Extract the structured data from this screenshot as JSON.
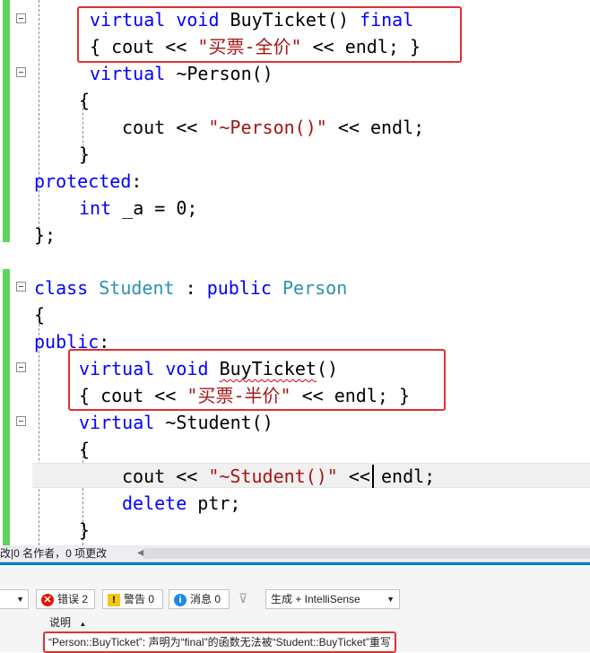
{
  "editor": {
    "lines": [
      {
        "segments": [
          [
            "kw",
            "virtual"
          ],
          [
            "",
            "void"
          ],
          [
            "",
            "BuyTicket() "
          ],
          [
            "kw",
            "final"
          ]
        ]
      },
      {
        "segments": [
          [
            "",
            "{ cout << "
          ],
          [
            "st",
            "\"买票-全价\""
          ],
          [
            "",
            " << endl; }"
          ]
        ]
      },
      {
        "segments": [
          [
            "kw",
            "virtual"
          ],
          [
            "",
            " ~Person()"
          ]
        ]
      },
      {
        "segments": [
          [
            "",
            "{"
          ]
        ]
      },
      {
        "segments": [
          [
            "",
            "cout << "
          ],
          [
            "st",
            "\"~Person()\""
          ],
          [
            "",
            " << endl;"
          ]
        ]
      },
      {
        "segments": [
          [
            "",
            "}"
          ]
        ]
      },
      {
        "segments": [
          [
            "kw",
            "protected"
          ],
          [
            "",
            ":"
          ]
        ]
      },
      {
        "segments": [
          [
            "kw",
            "int"
          ],
          [
            "",
            " _a = 0;"
          ]
        ]
      },
      {
        "segments": [
          [
            "",
            "};"
          ]
        ]
      },
      {
        "segments": [
          [
            "kw",
            "class"
          ],
          [
            "",
            " "
          ],
          [
            "ty",
            "Student"
          ],
          [
            "",
            " : "
          ],
          [
            "kw",
            "public"
          ],
          [
            "",
            " "
          ],
          [
            "ty",
            "Person"
          ]
        ]
      },
      {
        "segments": [
          [
            "",
            "{"
          ]
        ]
      },
      {
        "segments": [
          [
            "kw",
            "public"
          ],
          [
            "",
            ":"
          ]
        ]
      },
      {
        "segments": [
          [
            "kw",
            "virtual"
          ],
          [
            "",
            " "
          ],
          [
            "kw",
            "void"
          ],
          [
            "",
            " "
          ],
          [
            "squig",
            "BuyTicket"
          ],
          [
            "",
            "()"
          ]
        ]
      },
      {
        "segments": [
          [
            "",
            "{ cout << "
          ],
          [
            "st",
            "\"买票-半价\""
          ],
          [
            "",
            " << endl; }"
          ]
        ]
      },
      {
        "segments": [
          [
            "kw",
            "virtual"
          ],
          [
            "",
            " ~Student()"
          ]
        ]
      },
      {
        "segments": [
          [
            "",
            "{"
          ]
        ]
      },
      {
        "segments": [
          [
            "",
            "cout << "
          ],
          [
            "st",
            "\"~Student()\""
          ],
          [
            "",
            " << endl;"
          ]
        ]
      },
      {
        "segments": [
          [
            "kw",
            "delete"
          ],
          [
            "",
            " ptr;"
          ]
        ]
      },
      {
        "segments": [
          [
            "",
            "}"
          ]
        ]
      }
    ]
  },
  "status": {
    "changes": "改|0 名作者，0 项更改"
  },
  "errors": {
    "errors_label": "错误 2",
    "warnings_label": "警告 0",
    "messages_label": "消息 0",
    "build_filter": "生成 + IntelliSense",
    "column_header": "说明",
    "message": "“Person::BuyTicket”: 声明为“final”的函数无法被“Student::BuyTicket”重写"
  },
  "colors": {
    "keyword": "#0000ff",
    "type": "#2b91af",
    "string": "#a31515",
    "change_bar": "#5fd35f",
    "highlight_box": "#e03030"
  }
}
